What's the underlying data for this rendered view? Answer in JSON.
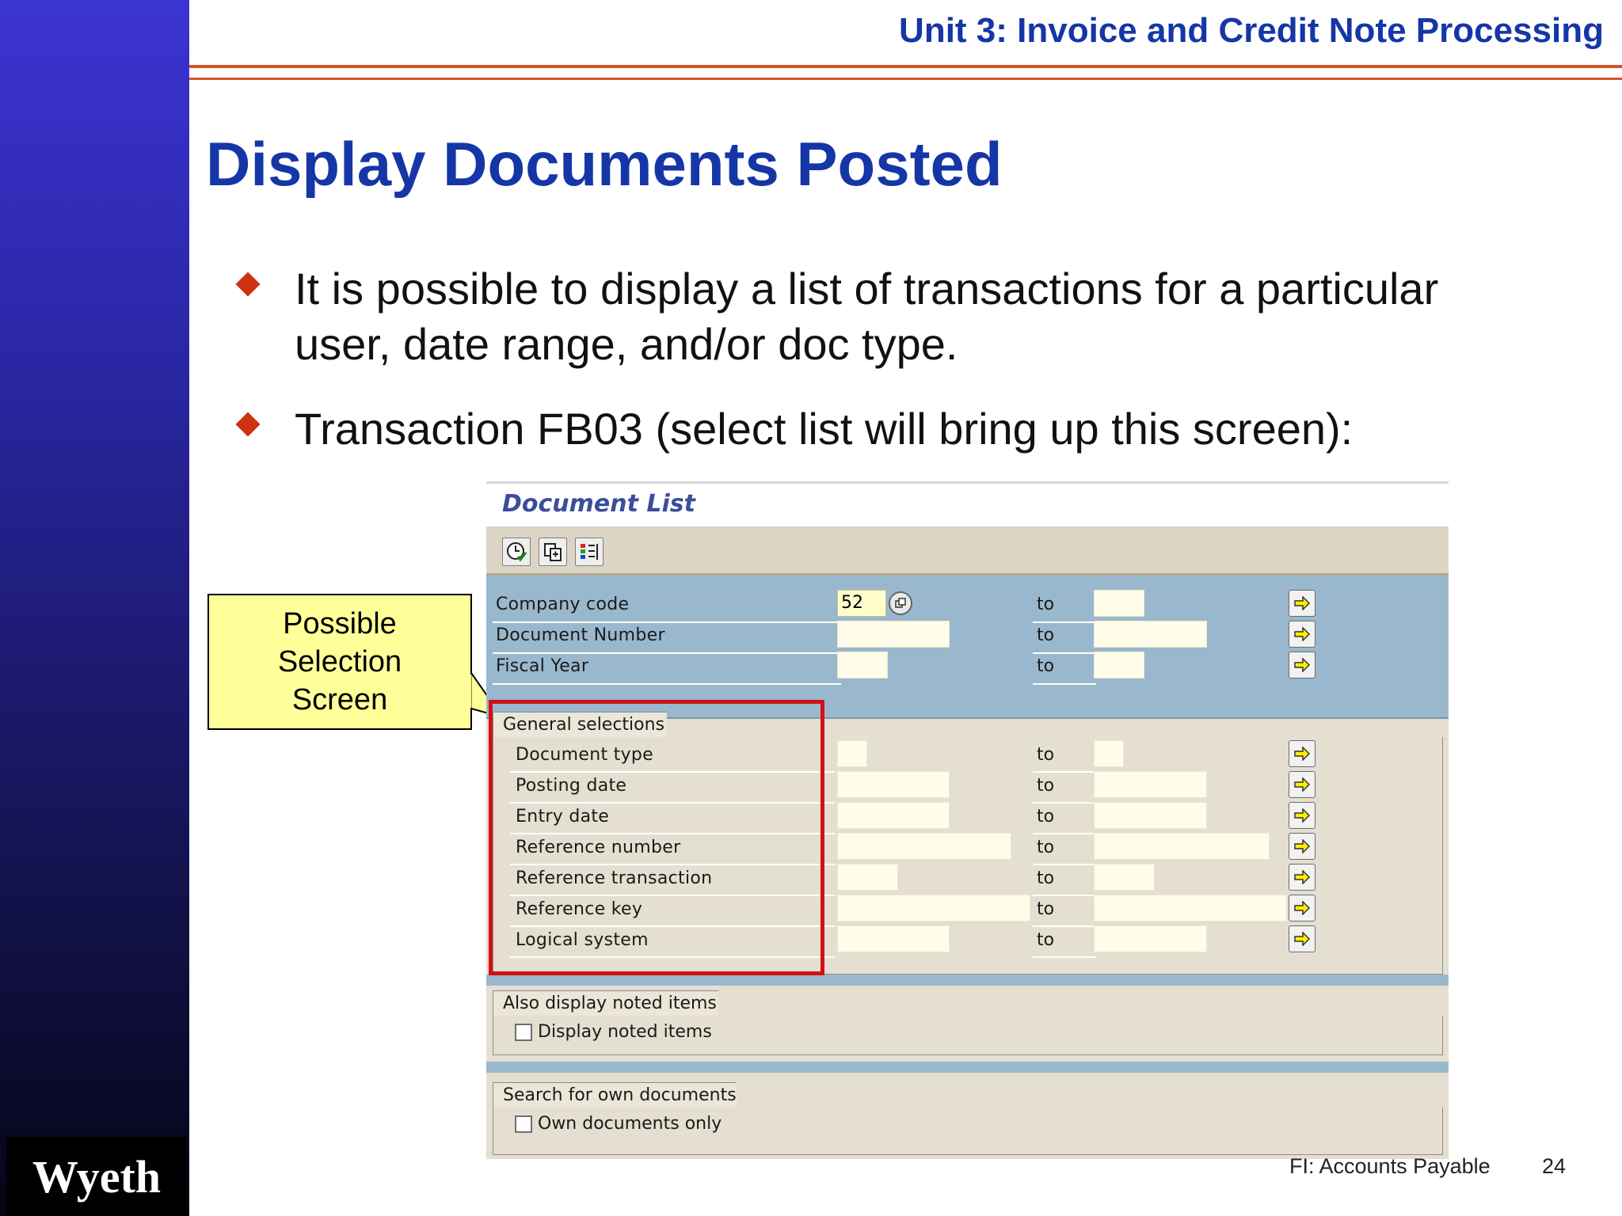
{
  "header": {
    "unit_title": "Unit 3: Invoice and Credit Note Processing"
  },
  "slide": {
    "title": "Display Documents Posted",
    "bullets": [
      {
        "text": "It is possible to display a list of transactions for a particular user, date range, and/or doc type."
      },
      {
        "text": "Transaction FB03 (select list will bring up this screen):"
      }
    ]
  },
  "callout": {
    "text": "Possible Selection Screen"
  },
  "sap_window": {
    "title": "Document List",
    "toolbar": [
      {
        "name": "execute-icon"
      },
      {
        "name": "copy-icon"
      },
      {
        "name": "dynamic-selections-icon"
      }
    ],
    "header_fields": [
      {
        "label": "Company code",
        "value": "52",
        "to": "to"
      },
      {
        "label": "Document Number",
        "value": "",
        "to": "to"
      },
      {
        "label": "Fiscal Year",
        "value": "",
        "to": "to"
      }
    ],
    "general_selections": {
      "title": "General selections",
      "fields": [
        {
          "label": "Document type",
          "to": "to"
        },
        {
          "label": "Posting date",
          "to": "to"
        },
        {
          "label": "Entry date",
          "to": "to"
        },
        {
          "label": "Reference number",
          "to": "to"
        },
        {
          "label": "Reference transaction",
          "to": "to"
        },
        {
          "label": "Reference key",
          "to": "to"
        },
        {
          "label": "Logical system",
          "to": "to"
        }
      ]
    },
    "noted_items": {
      "title": "Also display noted items",
      "checkbox_label": "Display noted items",
      "checked": false
    },
    "own_documents": {
      "title": "Search for own documents",
      "checkbox_label": "Own documents only",
      "checked": false
    }
  },
  "footer": {
    "course": "FI: Accounts Payable",
    "page_number": "24",
    "logo": "Wyeth"
  },
  "colors": {
    "title_blue": "#1536a6",
    "accent_orange": "#d2542a",
    "highlight_red": "#d21018",
    "callout_yellow": "#ffff99",
    "sap_blue_panel": "#9ab8cd",
    "sap_tan": "#e4dfd0"
  }
}
